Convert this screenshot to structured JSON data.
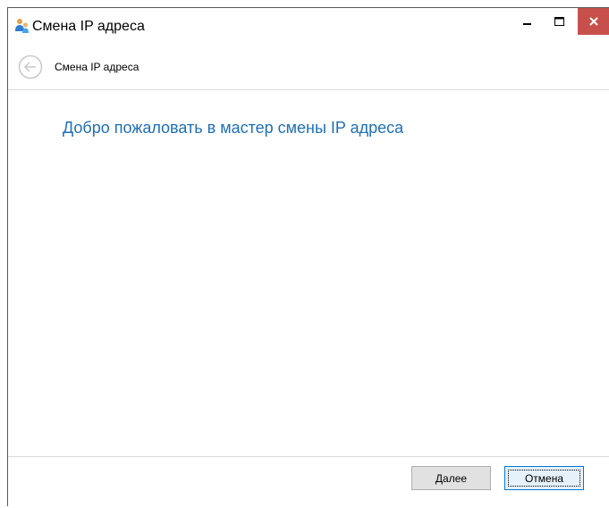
{
  "window": {
    "title": "Смена IP адреса",
    "controls": {
      "minimize": "minimize-icon",
      "maximize": "maximize-icon",
      "close": "close-icon"
    },
    "close_color": "#c7504b"
  },
  "nav": {
    "back_icon": "back-arrow-icon",
    "title": "Смена IP адреса"
  },
  "main": {
    "heading": "Добро пожаловать в мастер смены IP адреса",
    "heading_color": "#1e6fb7"
  },
  "footer": {
    "next_label": "Далее",
    "cancel_label": "Отмена"
  }
}
